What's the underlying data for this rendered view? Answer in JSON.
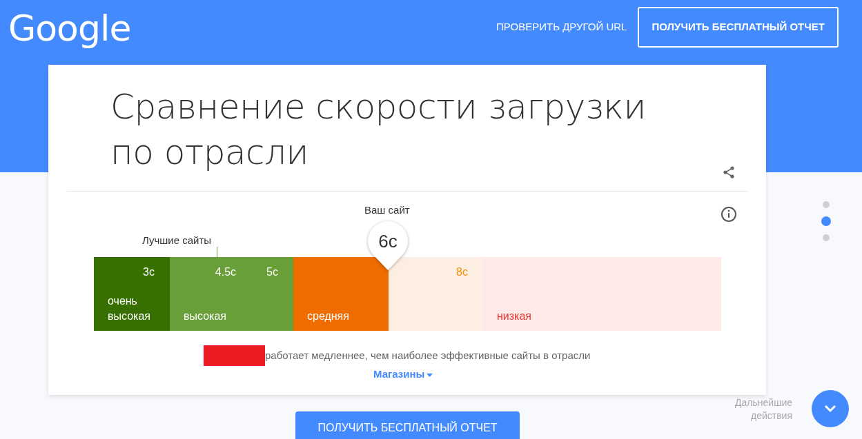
{
  "header": {
    "logo": "Google",
    "links": [
      {
        "label": "ПРОВЕРИТЬ ДРУГОЙ URL",
        "kind": "link"
      },
      {
        "label": "ПОЛУЧИТЬ БЕСПЛАТНЫЙ ОТЧЕТ",
        "kind": "outline"
      }
    ]
  },
  "card": {
    "title": "Сравнение скорости загрузки по отрасли",
    "your_site": {
      "label": "Ваш сайт",
      "value": "6с"
    },
    "best_sites": {
      "label": "Лучшие сайты"
    },
    "segments": [
      {
        "label": "очень высокая",
        "color": "#376f00",
        "ticks": [
          "3с"
        ]
      },
      {
        "label": "высокая",
        "color": "#689f38",
        "ticks": [
          "4.5с",
          "5с"
        ]
      },
      {
        "label": "средняя",
        "color": "#ef6c00"
      },
      {
        "color": "#fdeee4",
        "ticks": [
          "8с"
        ]
      },
      {
        "label": "низкая",
        "color": "#fde9e7"
      }
    ],
    "summary": "работает медленнее, чем наиболее эффективные сайты в отрасли",
    "industry": "Магазины"
  },
  "pager": [
    {
      "selected": false
    },
    {
      "selected": true
    },
    {
      "selected": false
    }
  ],
  "next_steps": "Дальнейшие действия",
  "bottom_button": "ПОЛУЧИТЬ БЕСПЛАТНЫЙ ОТЧЕТ"
}
